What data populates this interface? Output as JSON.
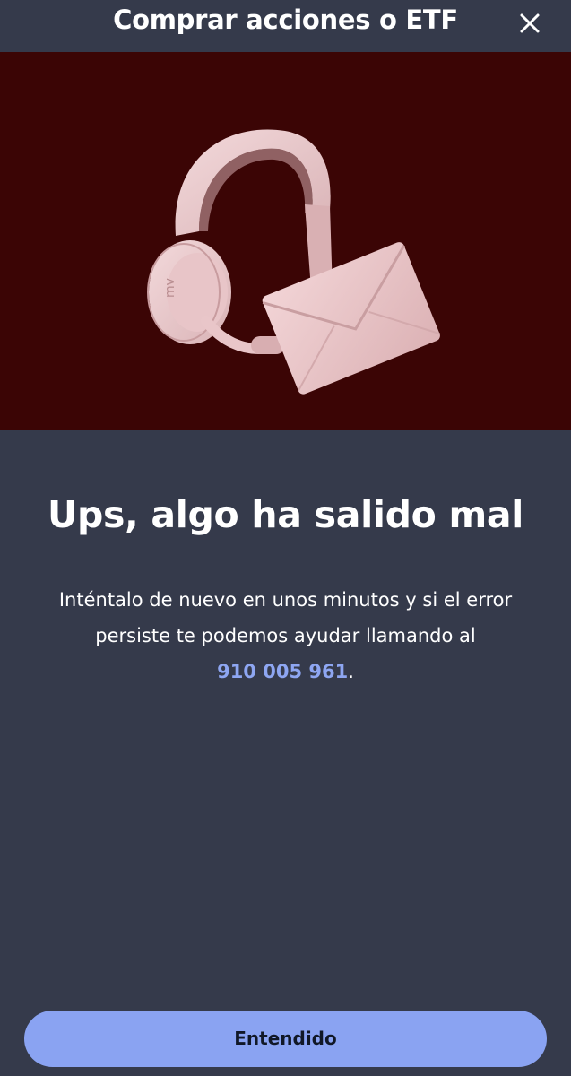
{
  "header": {
    "title": "Comprar acciones o ETF",
    "close_icon": "close-icon"
  },
  "hero": {
    "background_color": "#3b0505",
    "illustration": [
      "headset-icon",
      "envelope-icon"
    ],
    "headset_logo_text": "mv"
  },
  "error": {
    "title": "Ups, algo ha salido mal",
    "message_line1": "Inténtalo de nuevo en unos minutos y si el error",
    "message_line2": "persiste te podemos ayudar llamando al",
    "phone": "910 005 961",
    "phone_suffix": "."
  },
  "footer": {
    "button_label": "Entendido"
  },
  "colors": {
    "background": "#353a4b",
    "accent": "#8aa3f2",
    "link": "#8ea6f2"
  }
}
